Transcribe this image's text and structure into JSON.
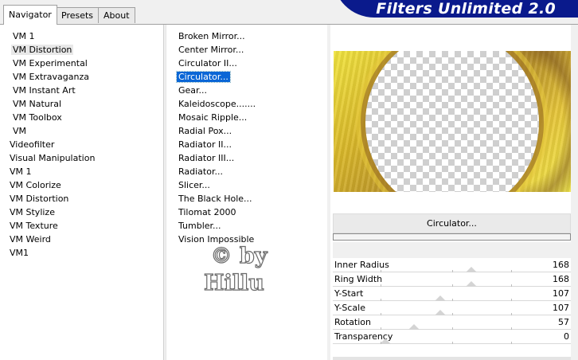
{
  "tabs": [
    {
      "label": "Navigator",
      "active": true
    },
    {
      "label": "Presets",
      "active": false
    },
    {
      "label": "About",
      "active": false
    }
  ],
  "banner": {
    "title": "Filters Unlimited 2.0"
  },
  "categories": [
    "VM 1",
    "VM Distortion",
    "VM Experimental",
    "VM Extravaganza",
    "VM Instant Art",
    "VM Natural",
    "VM Toolbox",
    "VM",
    "Videofilter",
    "Visual Manipulation",
    "VM 1",
    "VM Colorize",
    "VM Distortion",
    "VM Stylize",
    "VM Texture",
    "VM Weird",
    "VM1"
  ],
  "selected_category": "VM Distortion",
  "filters": [
    "Broken Mirror...",
    "Center Mirror...",
    "Circulator II...",
    "Circulator...",
    "Gear...",
    "Kaleidoscope.......",
    "Mosaic Ripple...",
    "Radial Pox...",
    "Radiator II...",
    "Radiator III...",
    "Radiator...",
    "Slicer...",
    "The Black Hole...",
    "Tilomat 2000",
    "Tumbler...",
    "Vision Impossible"
  ],
  "selected_filter": "Circulator...",
  "watermark": {
    "line1": "© by",
    "line2": "Hillu"
  },
  "active_filter_title": "Circulator...",
  "parameters": [
    {
      "label": "Inner Radius",
      "value": "168",
      "level": 0.66
    },
    {
      "label": "Ring Width",
      "value": "168",
      "level": 0.66
    },
    {
      "label": "Y-Start",
      "value": "107",
      "level": 0.42
    },
    {
      "label": "Y-Scale",
      "value": "107",
      "level": 0.42
    },
    {
      "label": "Rotation",
      "value": "57",
      "level": 0.22
    },
    {
      "label": "Transparency",
      "value": "0",
      "level": 0.0
    }
  ],
  "colors": {
    "banner": "#0a1a8c",
    "selection": "#0a66d6",
    "preview_gold": "#d9b72a"
  },
  "icons": {
    "preview": "checkerboard-transparency"
  }
}
